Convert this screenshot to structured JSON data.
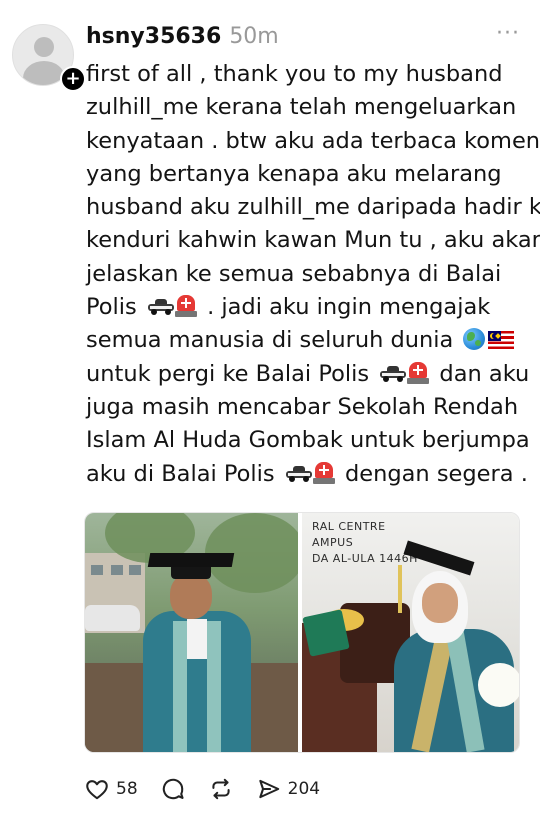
{
  "post": {
    "username": "hsny35636",
    "time": "50m",
    "more_label": "···",
    "follow_label": "+",
    "text_lines": [
      "first of all , thank you to my husband",
      "zulhill_me kerana telah mengeluarkan",
      "kenyataan . btw aku ada terbaca komen",
      "yang bertanya kenapa aku melarang",
      "husband aku zulhill_me daripada hadir ke",
      "kenduri kahwin kawan Mun tu , aku akan",
      "jelaskan ke semua sebabnya di Balai",
      "Polis",
      ". jadi aku ingin mengajak",
      "semua manusia di seluruh dunia",
      "untuk pergi ke Balai Polis",
      "dan aku",
      "juga masih mencabar Sekolah Rendah",
      "Islam Al Huda Gombak untuk berjumpa",
      "aku di Balai Polis",
      "dengan segera ."
    ],
    "emojis": {
      "police_car": "police-car-emoji",
      "siren": "rotating-light-emoji",
      "globe": "globe-emoji",
      "flag": "malaysia-flag-emoji"
    },
    "image": {
      "sign_lines": [
        "RAL CENTRE",
        "AMPUS",
        "DA AL-ULA 1446H"
      ]
    },
    "actions": {
      "likes": "58",
      "shares": "204"
    }
  },
  "colors": {
    "text": "#141414",
    "muted": "#999999",
    "background": "#ffffff"
  }
}
